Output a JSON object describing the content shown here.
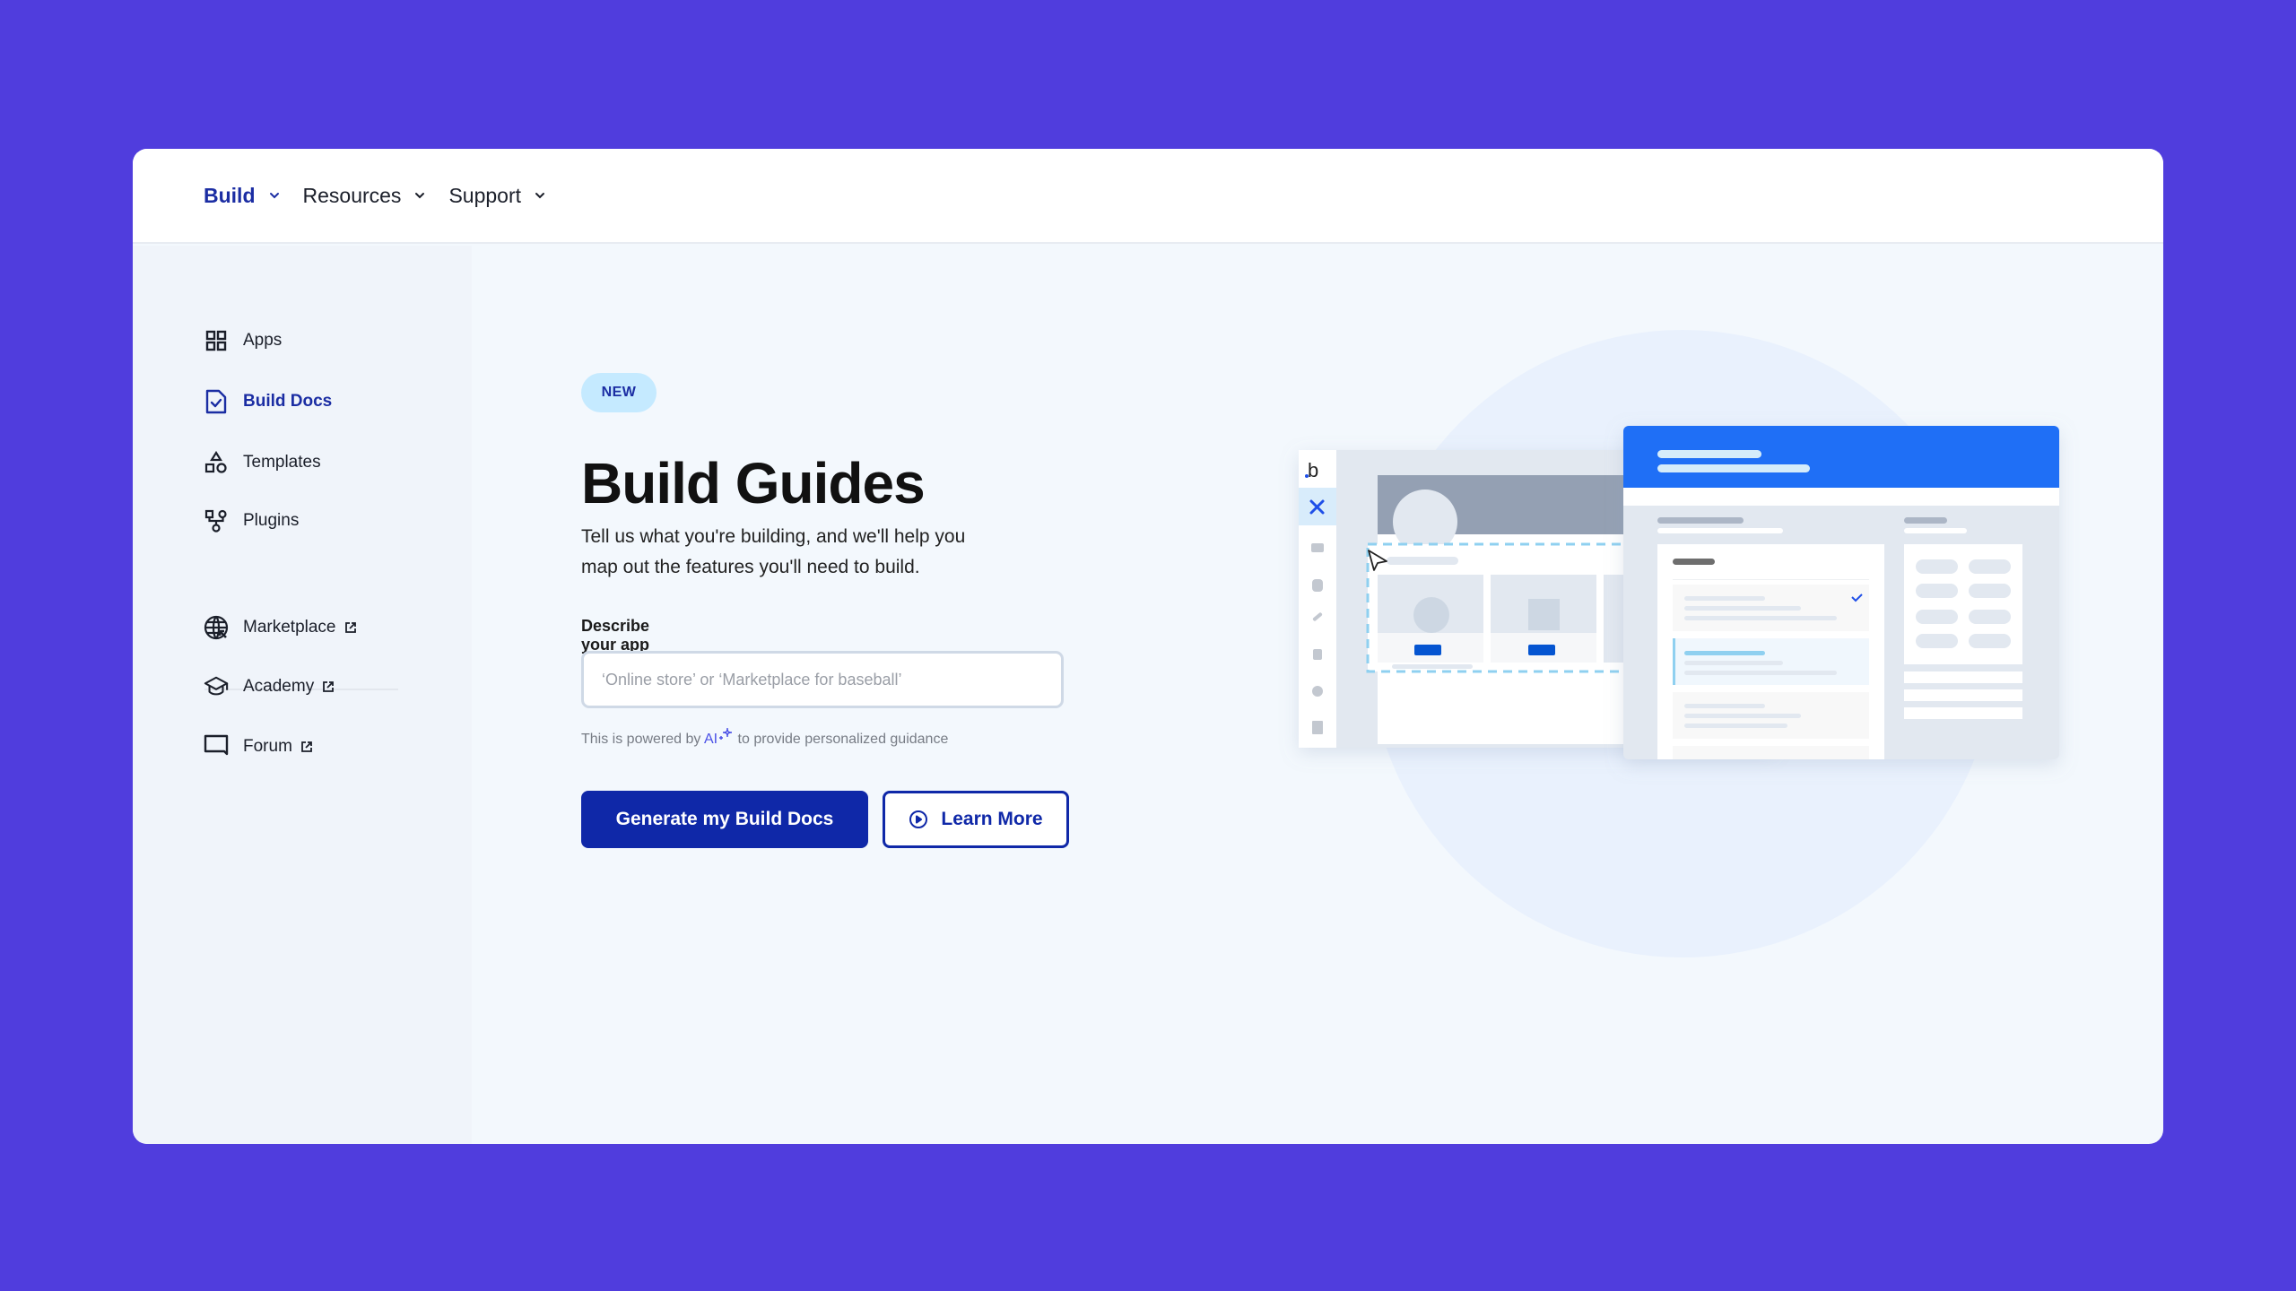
{
  "nav": {
    "items": [
      {
        "label": "Build",
        "active": true
      },
      {
        "label": "Resources",
        "active": false
      },
      {
        "label": "Support",
        "active": false
      }
    ]
  },
  "sidebar": {
    "items": [
      {
        "label": "Apps",
        "icon": "apps-grid-icon"
      },
      {
        "label": "Build Docs",
        "icon": "document-check-icon",
        "active": true
      },
      {
        "label": "Templates",
        "icon": "shapes-icon"
      },
      {
        "label": "Plugins",
        "icon": "plugin-icon"
      }
    ],
    "external": [
      {
        "label": "Marketplace",
        "icon": "globe-icon"
      },
      {
        "label": "Academy",
        "icon": "graduation-cap-icon"
      },
      {
        "label": "Forum",
        "icon": "chat-bubble-icon"
      }
    ]
  },
  "main": {
    "badge": "NEW",
    "title": "Build Guides",
    "subtitle": "Tell us what you're building, and we'll help you map out the features you'll need to build.",
    "field_label": "Describe your app idea.",
    "input_placeholder": "‘Online store’ or ‘Marketplace for baseball’",
    "input_value": "",
    "powered_prefix": "This is powered by ",
    "powered_ai": "AI",
    "powered_suffix": " to provide personalized guidance",
    "primary_button": "Generate my Build Docs",
    "secondary_button": "Learn More"
  },
  "illustration": {
    "logo": ".b",
    "colors": {
      "accent": "#1f6ff6",
      "brand": "#0f28a8",
      "background": "#503ddd"
    }
  }
}
